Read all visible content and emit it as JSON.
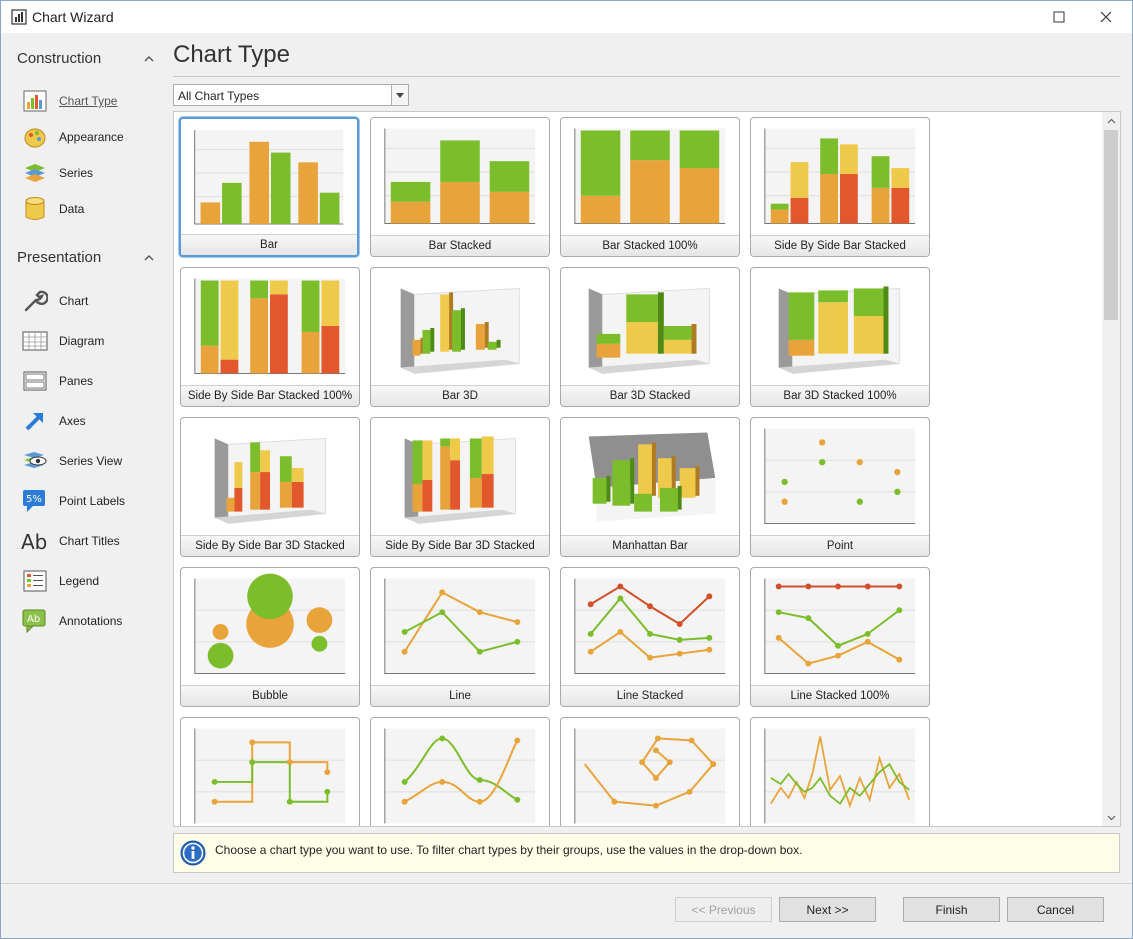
{
  "window": {
    "title": "Chart Wizard"
  },
  "sidebar": {
    "groups": [
      {
        "label": "Construction",
        "items": [
          {
            "label": "Chart Type",
            "icon": "bar-chart-icon",
            "active": true
          },
          {
            "label": "Appearance",
            "icon": "palette-icon"
          },
          {
            "label": "Series",
            "icon": "series-icon"
          },
          {
            "label": "Data",
            "icon": "database-icon"
          }
        ]
      },
      {
        "label": "Presentation",
        "items": [
          {
            "label": "Chart",
            "icon": "wrench-icon"
          },
          {
            "label": "Diagram",
            "icon": "diagram-grid-icon"
          },
          {
            "label": "Panes",
            "icon": "panes-icon"
          },
          {
            "label": "Axes",
            "icon": "axes-arrow-icon"
          },
          {
            "label": "Series View",
            "icon": "series-view-icon"
          },
          {
            "label": "Point Labels",
            "icon": "point-labels-icon"
          },
          {
            "label": "Chart Titles",
            "icon": "chart-titles-icon"
          },
          {
            "label": "Legend",
            "icon": "legend-icon"
          },
          {
            "label": "Annotations",
            "icon": "annotations-icon"
          }
        ]
      }
    ]
  },
  "main": {
    "title": "Chart Type",
    "filter": {
      "value": "All Chart Types"
    },
    "tiles": [
      "Bar",
      "Bar Stacked",
      "Bar Stacked 100%",
      "Side By Side Bar Stacked",
      "Side By Side Bar Stacked 100%",
      "Bar 3D",
      "Bar 3D Stacked",
      "Bar 3D Stacked 100%",
      "Side By Side Bar 3D Stacked",
      "Side By Side Bar 3D Stacked 100%",
      "Manhattan Bar",
      "Point",
      "Bubble",
      "Line",
      "Line Stacked",
      "Line Stacked 100%",
      "",
      "",
      "",
      ""
    ],
    "selected_tile": "Bar",
    "hint": "Choose a chart type you want to use. To filter chart types by their groups, use the values in the drop-down box."
  },
  "buttons": {
    "previous": "<< Previous",
    "next": "Next >>",
    "finish": "Finish",
    "cancel": "Cancel"
  },
  "colors": {
    "orange": "#e8a33a",
    "green": "#7bbd2a",
    "red": "#e2572b",
    "yellow": "#efc94a",
    "selection": "#5b9bd5"
  }
}
